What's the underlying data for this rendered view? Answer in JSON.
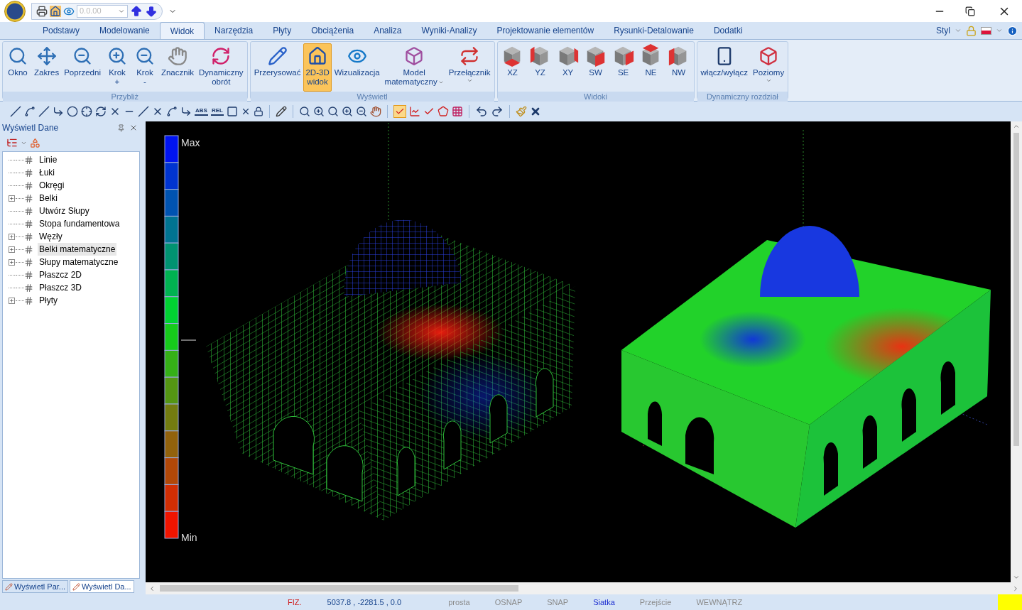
{
  "quick_access": {
    "field_value": "0.0.00"
  },
  "ribbon_tabs": [
    {
      "label": "Podstawy",
      "selected": false
    },
    {
      "label": "Modelowanie",
      "selected": false
    },
    {
      "label": "Widok",
      "selected": true
    },
    {
      "label": "Narzędzia",
      "selected": false
    },
    {
      "label": "Płyty",
      "selected": false
    },
    {
      "label": "Obciążenia",
      "selected": false
    },
    {
      "label": "Analiza",
      "selected": false
    },
    {
      "label": "Wyniki-Analizy",
      "selected": false
    },
    {
      "label": "Projektowanie elementów",
      "selected": false
    },
    {
      "label": "Rysunki-Detalowanie",
      "selected": false
    },
    {
      "label": "Dodatki",
      "selected": false
    }
  ],
  "style_menu": {
    "label": "Styl"
  },
  "ribbon_groups": [
    {
      "title": "Przybliż",
      "items": [
        {
          "label": "Okno",
          "selected": false,
          "dropdown": false
        },
        {
          "label": "Zakres",
          "selected": false,
          "dropdown": false
        },
        {
          "label": "Poprzedni",
          "selected": false,
          "dropdown": false
        },
        {
          "label": "Krok",
          "sub": "+",
          "selected": false,
          "dropdown": false
        },
        {
          "label": "Krok",
          "sub": "-",
          "selected": false,
          "dropdown": false
        },
        {
          "label": "Znacznik",
          "selected": false,
          "dropdown": false
        },
        {
          "label": "Dynamiczny",
          "sub": "obrót",
          "selected": false,
          "dropdown": false
        }
      ]
    },
    {
      "title": "Wyświetl",
      "items": [
        {
          "label": "Przerysować",
          "selected": false,
          "dropdown": false
        },
        {
          "label": "2D-3D",
          "sub": "widok",
          "selected": true,
          "dropdown": false
        },
        {
          "label": "Wizualizacja",
          "selected": false,
          "dropdown": false
        },
        {
          "label": "Model",
          "sub": "matematyczny",
          "selected": false,
          "dropdown": true
        },
        {
          "label": "Przełącznik",
          "selected": false,
          "dropdown": true
        }
      ]
    },
    {
      "title": "Widoki",
      "items": [
        {
          "label": "XZ",
          "selected": false,
          "dropdown": false
        },
        {
          "label": "YZ",
          "selected": false,
          "dropdown": false
        },
        {
          "label": "XY",
          "selected": false,
          "dropdown": false
        },
        {
          "label": "SW",
          "selected": false,
          "dropdown": false
        },
        {
          "label": "SE",
          "selected": false,
          "dropdown": false
        },
        {
          "label": "NE",
          "selected": false,
          "dropdown": false
        },
        {
          "label": "NW",
          "selected": false,
          "dropdown": false
        }
      ]
    },
    {
      "title": "Dynamiczny rozdział",
      "items": [
        {
          "label": "włącz/wyłącz",
          "selected": false,
          "dropdown": false
        },
        {
          "label": "Poziomy",
          "selected": false,
          "dropdown": true
        }
      ]
    }
  ],
  "toolbar": {
    "labeled_tools": [
      "ABS",
      "REL"
    ],
    "check_tool_selected": true
  },
  "data_panel": {
    "title": "Wyświetl Dane",
    "tree": [
      {
        "label": "Linie",
        "expander": false,
        "selected": false
      },
      {
        "label": "Łuki",
        "expander": false,
        "selected": false
      },
      {
        "label": "Okręgi",
        "expander": false,
        "selected": false
      },
      {
        "label": "Belki",
        "expander": true,
        "selected": false
      },
      {
        "label": "Utwórz Słupy",
        "expander": false,
        "selected": false
      },
      {
        "label": "Stopa fundamentowa",
        "expander": false,
        "selected": false
      },
      {
        "label": "Węzły",
        "expander": true,
        "selected": false
      },
      {
        "label": "Belki matematyczne",
        "expander": true,
        "selected": true
      },
      {
        "label": "Słupy matematyczne",
        "expander": true,
        "selected": false
      },
      {
        "label": "Płaszcz 2D",
        "expander": false,
        "selected": false
      },
      {
        "label": "Płaszcz 3D",
        "expander": false,
        "selected": false
      },
      {
        "label": "Płyty",
        "expander": true,
        "selected": false
      }
    ],
    "bottom_tabs": [
      {
        "label": "Wyświetl Par...",
        "selected": false
      },
      {
        "label": "Wyświetl Da...",
        "selected": true
      }
    ]
  },
  "viewport": {
    "legend": {
      "max_label": "Max",
      "min_label": "Min"
    }
  },
  "status_bar": [
    {
      "kind": "flag",
      "text": "FIZ."
    },
    {
      "kind": "coords",
      "text": "5037.8 , -2281.5 , 0.0"
    },
    {
      "kind": "mode",
      "text": "prosta",
      "on": false
    },
    {
      "kind": "mode",
      "text": "OSNAP",
      "on": false
    },
    {
      "kind": "mode",
      "text": "SNAP",
      "on": false
    },
    {
      "kind": "mode",
      "text": "Siatka",
      "on": true
    },
    {
      "kind": "mode",
      "text": "Przejście",
      "on": false
    },
    {
      "kind": "mode",
      "text": "WEWNĄTRZ",
      "on": false
    }
  ]
}
